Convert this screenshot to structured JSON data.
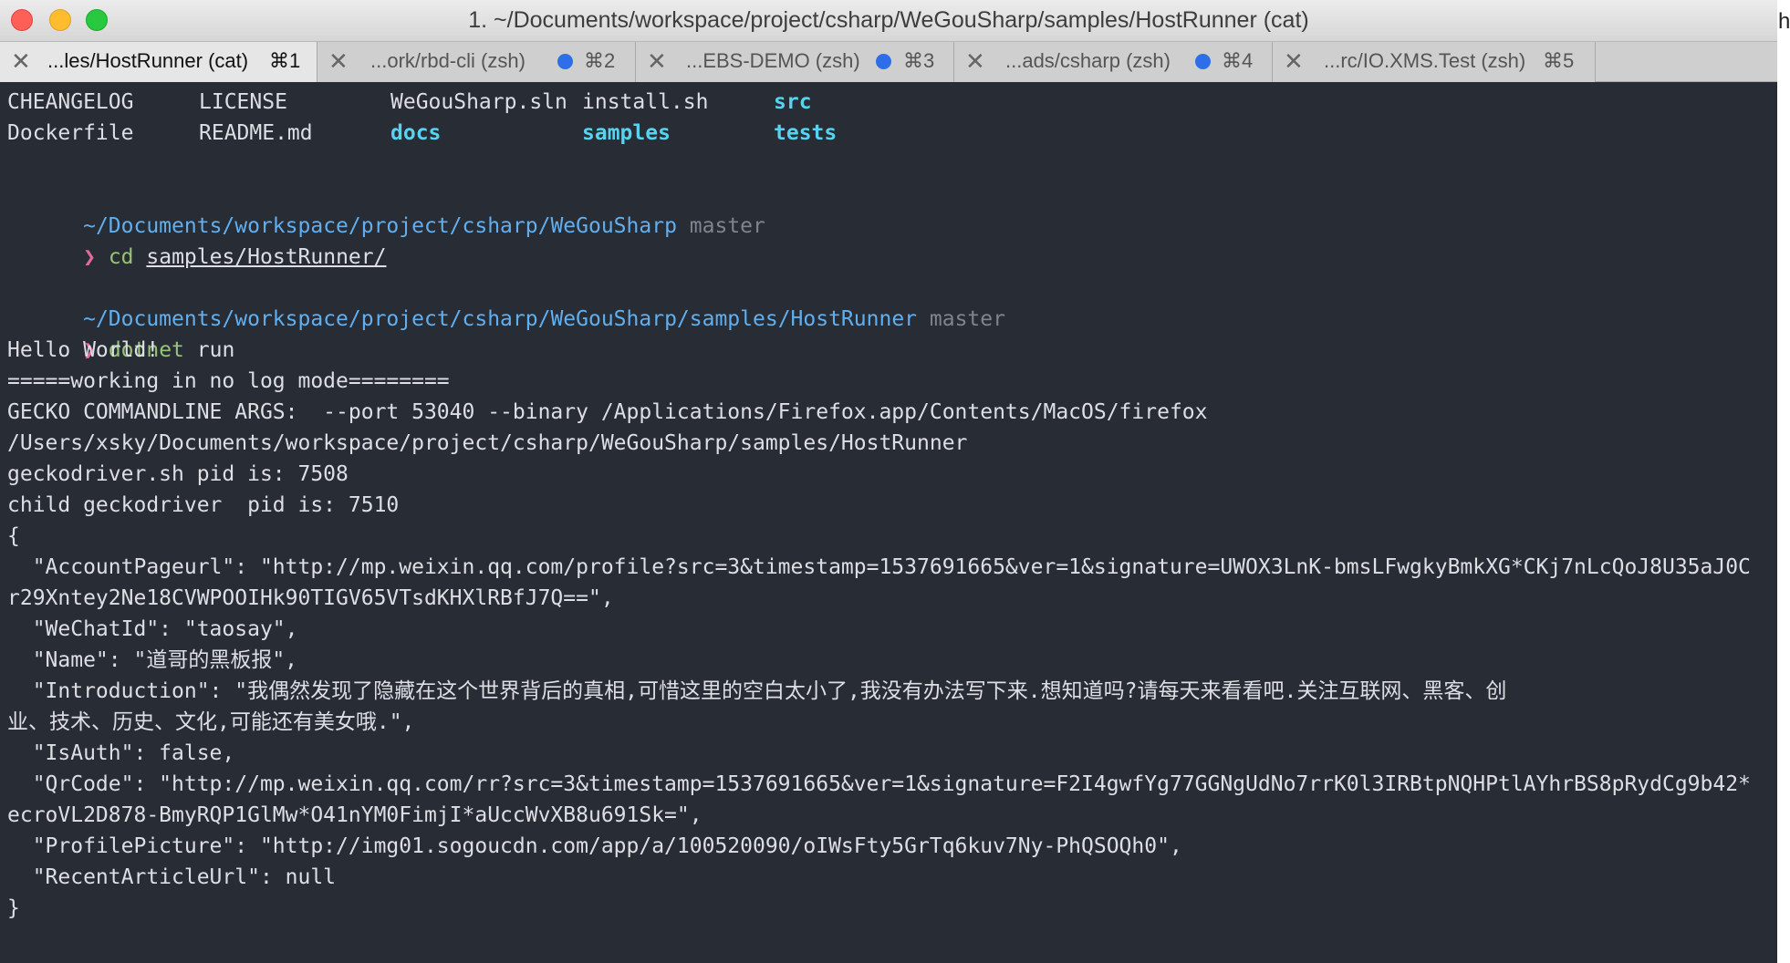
{
  "window": {
    "title": "1. ~/Documents/workspace/project/csharp/WeGouSharp/samples/HostRunner (cat)",
    "edge_glyph": "h"
  },
  "tabs": [
    {
      "label": "...les/HostRunner (cat)",
      "shortcut": "⌘1",
      "active": true,
      "dot": false
    },
    {
      "label": "...ork/rbd-cli (zsh)",
      "shortcut": "⌘2",
      "active": false,
      "dot": true
    },
    {
      "label": "...EBS-DEMO (zsh)",
      "shortcut": "⌘3",
      "active": false,
      "dot": true
    },
    {
      "label": "...ads/csharp (zsh)",
      "shortcut": "⌘4",
      "active": false,
      "dot": true
    },
    {
      "label": "...rc/IO.XMS.Test (zsh)",
      "shortcut": "⌘5",
      "active": false,
      "dot": false
    }
  ],
  "tab_close_glyph": "✕",
  "terminal": {
    "ls_row1": [
      "CHEANGELOG",
      "LICENSE",
      "WeGouSharp.sln",
      "install.sh",
      "src"
    ],
    "ls_row2": [
      "Dockerfile",
      "README.md",
      "docs",
      "samples",
      "tests"
    ],
    "prompt1_path": "~/Documents/workspace/project/csharp/WeGouSharp",
    "prompt1_branch": "master",
    "prompt_symbol": "❯",
    "cmd1": "cd",
    "cmd1_arg": "samples/HostRunner/",
    "prompt2_path": "~/Documents/workspace/project/csharp/WeGouSharp/samples/HostRunner",
    "prompt2_branch": "master",
    "cmd2": "dotnet",
    "cmd2_arg": "run",
    "output": [
      "Hello World!",
      "=====working in no log mode========",
      "GECKO COMMANDLINE ARGS:  --port 53040 --binary /Applications/Firefox.app/Contents/MacOS/firefox",
      "/Users/xsky/Documents/workspace/project/csharp/WeGouSharp/samples/HostRunner",
      "geckodriver.sh pid is: 7508",
      "child geckodriver  pid is: 7510",
      "{",
      "  \"AccountPageurl\": \"http://mp.weixin.qq.com/profile?src=3&timestamp=1537691665&ver=1&signature=UWOX3LnK-bmsLFwgkyBmkXG*CKj7nLcQoJ8U35aJ0C",
      "r29Xntey2Ne18CVWPOOIHk90TIGV65VTsdKHXlRBfJ7Q==\",",
      "  \"WeChatId\": \"taosay\",",
      "  \"Name\": \"道哥的黑板报\",",
      "  \"Introduction\": \"我偶然发现了隐藏在这个世界背后的真相,可惜这里的空白太小了,我没有办法写下来.想知道吗?请每天来看看吧.关注互联网、黑客、创",
      "业、技术、历史、文化,可能还有美女哦.\",",
      "  \"IsAuth\": false,",
      "  \"QrCode\": \"http://mp.weixin.qq.com/rr?src=3&timestamp=1537691665&ver=1&signature=F2I4gwfYg77GGNgUdNo7rrK0l3IRBtpNQHPtlAYhrBS8pRydCg9b42*",
      "ecroVL2D878-BmyRQP1GlMw*O41nYM0FimjI*aUccWvXB8u691Sk=\",",
      "  \"ProfilePicture\": \"http://img01.sogoucdn.com/app/a/100520090/oIWsFty5GrTq6kuv7Ny-PhQSOQh0\",",
      "  \"RecentArticleUrl\": null",
      "}"
    ]
  }
}
